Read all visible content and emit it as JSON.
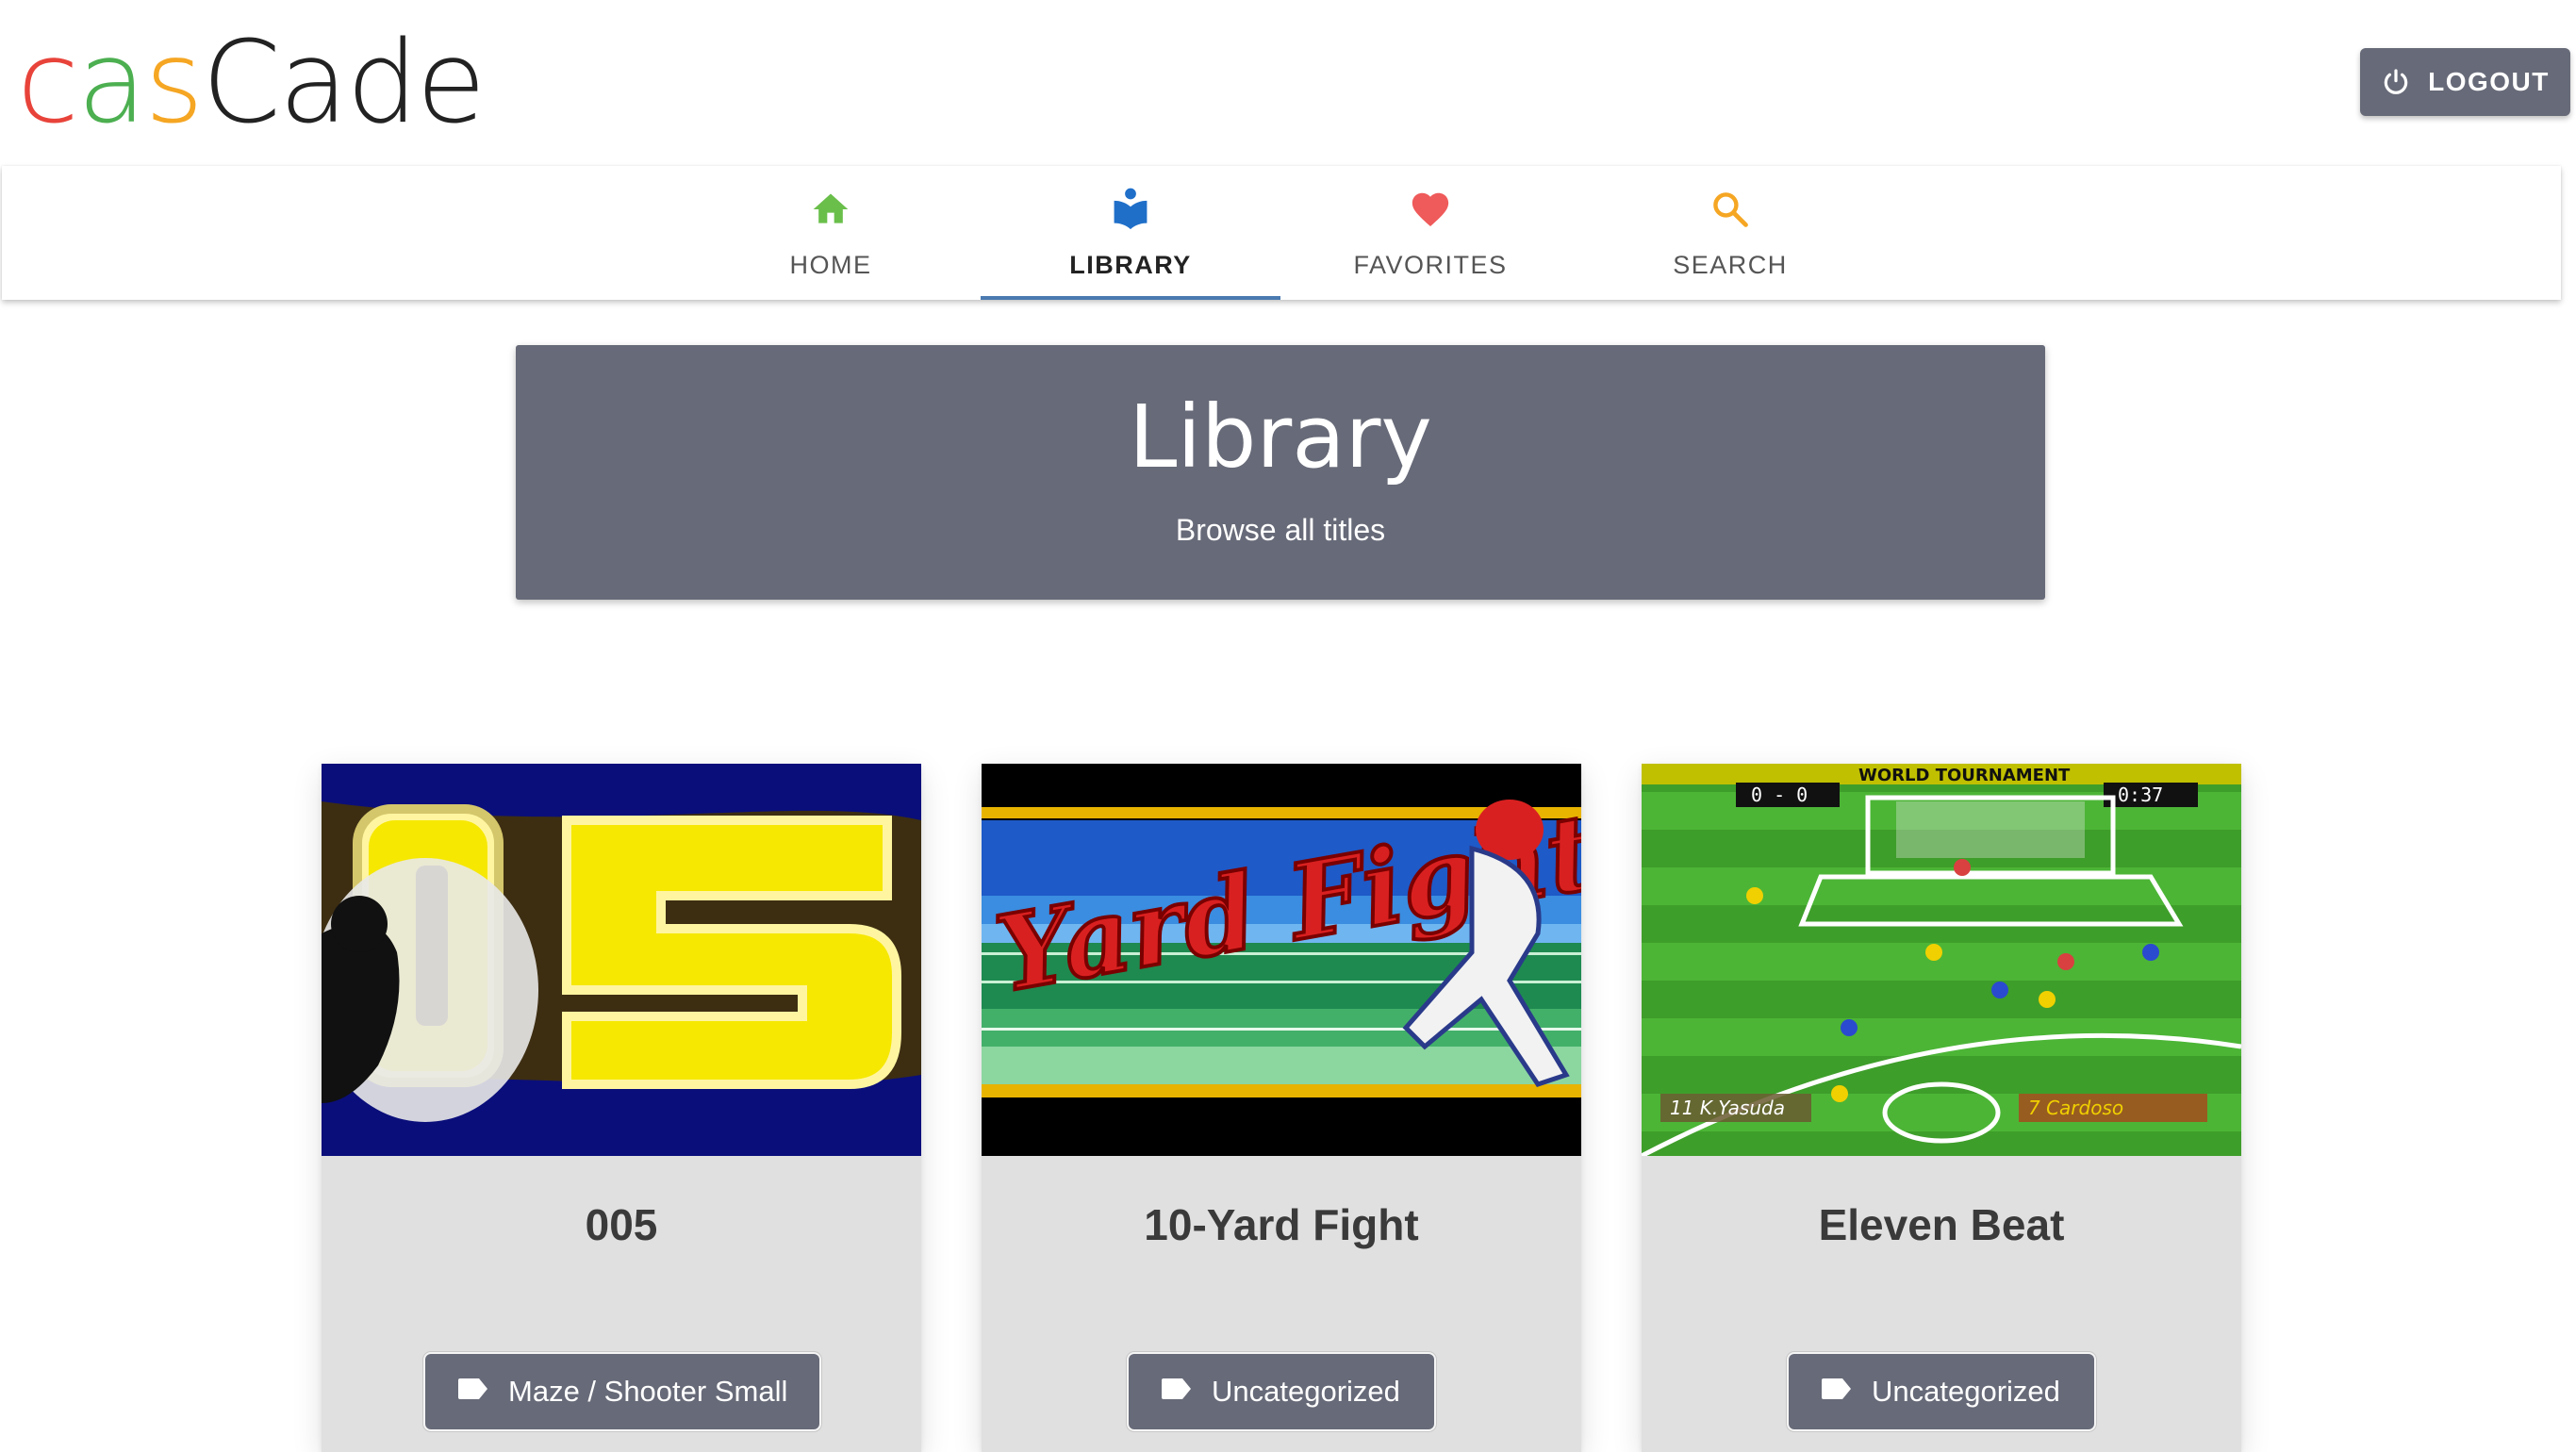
{
  "brand": {
    "letters": [
      {
        "ch": "c",
        "color": "#e8433a"
      },
      {
        "ch": "a",
        "color": "#4caf50"
      },
      {
        "ch": "s",
        "color": "#f5a623"
      },
      {
        "ch": "Cade",
        "color": "#222222"
      }
    ]
  },
  "header": {
    "logout_label": "LOGOUT",
    "logout_icon": "power-icon"
  },
  "tabs": [
    {
      "label": "HOME",
      "icon": "home-icon",
      "color": "#6abf4b",
      "active": false
    },
    {
      "label": "LIBRARY",
      "icon": "library-icon",
      "color": "#1f6fc9",
      "active": true
    },
    {
      "label": "FAVORITES",
      "icon": "heart-icon",
      "color": "#ef5a5a",
      "active": false
    },
    {
      "label": "SEARCH",
      "icon": "search-icon",
      "color": "#f5a623",
      "active": false
    }
  ],
  "banner": {
    "title": "Library",
    "subtitle": "Browse all titles"
  },
  "games": [
    {
      "title": "005",
      "tag": "Maze / Shooter Small",
      "thumb_text": "05"
    },
    {
      "title": "10-Yard Fight",
      "tag": "Uncategorized",
      "thumb_text": "Yard Fight"
    },
    {
      "title": "Eleven Beat",
      "tag": "Uncategorized",
      "thumb_text_top": "WORLD TOURNAMENT",
      "score": "0 - 0",
      "clock": "0:37",
      "player_left": "11 K.Yasuda",
      "player_right": "7 Cardoso"
    }
  ],
  "colors": {
    "accent": "#676a78",
    "tab_indicator": "#4a7ab0",
    "card_bg": "#e0e0e0"
  }
}
